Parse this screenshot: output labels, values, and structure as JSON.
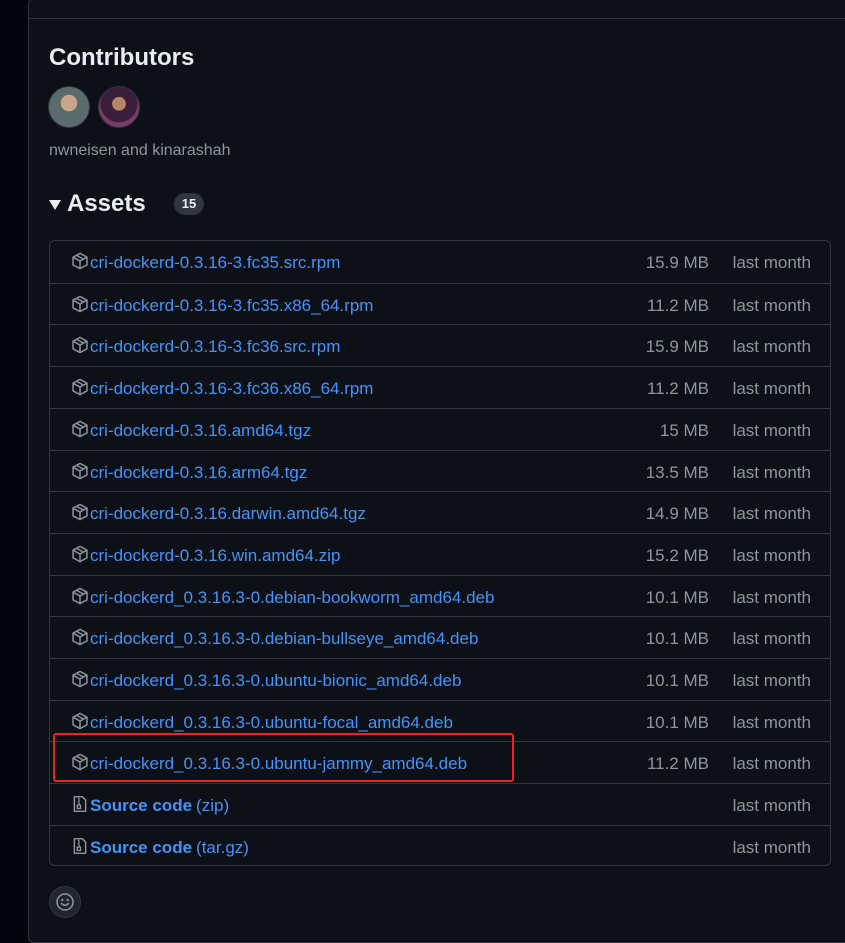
{
  "contributors": {
    "title": "Contributors",
    "names": "nwneisen and kinarashah",
    "avatars": [
      "nwneisen",
      "kinarashah"
    ]
  },
  "assets": {
    "title": "Assets",
    "count": "15",
    "items": [
      {
        "name": "cri-dockerd-0.3.16-3.fc35.src.rpm",
        "size": "15.9 MB",
        "date": "last month",
        "icon": "package-icon"
      },
      {
        "name": "cri-dockerd-0.3.16-3.fc35.x86_64.rpm",
        "size": "11.2 MB",
        "date": "last month",
        "icon": "package-icon"
      },
      {
        "name": "cri-dockerd-0.3.16-3.fc36.src.rpm",
        "size": "15.9 MB",
        "date": "last month",
        "icon": "package-icon"
      },
      {
        "name": "cri-dockerd-0.3.16-3.fc36.x86_64.rpm",
        "size": "11.2 MB",
        "date": "last month",
        "icon": "package-icon"
      },
      {
        "name": "cri-dockerd-0.3.16.amd64.tgz",
        "size": "15 MB",
        "date": "last month",
        "icon": "package-icon"
      },
      {
        "name": "cri-dockerd-0.3.16.arm64.tgz",
        "size": "13.5 MB",
        "date": "last month",
        "icon": "package-icon"
      },
      {
        "name": "cri-dockerd-0.3.16.darwin.amd64.tgz",
        "size": "14.9 MB",
        "date": "last month",
        "icon": "package-icon"
      },
      {
        "name": "cri-dockerd-0.3.16.win.amd64.zip",
        "size": "15.2 MB",
        "date": "last month",
        "icon": "package-icon"
      },
      {
        "name": "cri-dockerd_0.3.16.3-0.debian-bookworm_amd64.deb",
        "size": "10.1 MB",
        "date": "last month",
        "icon": "package-icon"
      },
      {
        "name": "cri-dockerd_0.3.16.3-0.debian-bullseye_amd64.deb",
        "size": "10.1 MB",
        "date": "last month",
        "icon": "package-icon"
      },
      {
        "name": "cri-dockerd_0.3.16.3-0.ubuntu-bionic_amd64.deb",
        "size": "10.1 MB",
        "date": "last month",
        "icon": "package-icon"
      },
      {
        "name": "cri-dockerd_0.3.16.3-0.ubuntu-focal_amd64.deb",
        "size": "10.1 MB",
        "date": "last month",
        "icon": "package-icon"
      },
      {
        "name": "cri-dockerd_0.3.16.3-0.ubuntu-jammy_amd64.deb",
        "size": "11.2 MB",
        "date": "last month",
        "icon": "package-icon"
      }
    ],
    "source": [
      {
        "label": "Source code",
        "ext": "(zip)",
        "date": "last month",
        "icon": "file-zip-icon"
      },
      {
        "label": "Source code",
        "ext": "(tar.gz)",
        "date": "last month",
        "icon": "file-zip-icon"
      }
    ]
  },
  "colors": {
    "link": "#4493f8",
    "muted": "#8d96a0",
    "highlight": "#e8251e"
  }
}
